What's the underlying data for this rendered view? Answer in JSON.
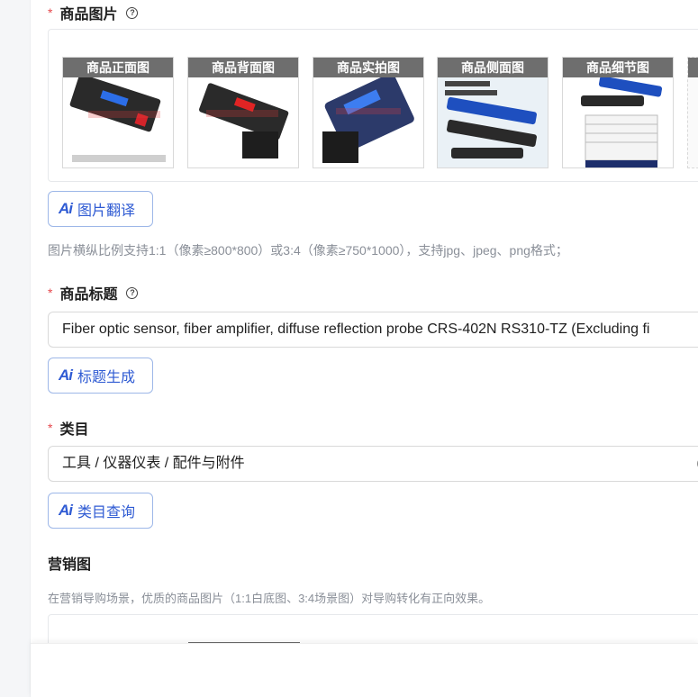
{
  "images_field": {
    "required_mark": "*",
    "label": "商品图片",
    "help_icon": "question-circle-icon",
    "thumbnails": [
      {
        "caption": "商品正面图",
        "art": "front"
      },
      {
        "caption": "商品背面图",
        "art": "back"
      },
      {
        "caption": "商品实拍图",
        "art": "real"
      },
      {
        "caption": "商品侧面图",
        "art": "side"
      },
      {
        "caption": "商品细节图",
        "art": "detail"
      }
    ],
    "ai_button": {
      "icon": "Ai",
      "label": "图片翻译"
    },
    "hint": "图片横纵比例支持1:1（像素≥800*800）或3:4（像素≥750*1000），支持jpg、jpeg、png格式；"
  },
  "title_field": {
    "required_mark": "*",
    "label": "商品标题",
    "help_icon": "question-circle-icon",
    "value": "Fiber optic sensor, fiber amplifier, diffuse reflection probe CRS-402N RS310-TZ (Excluding fi",
    "ai_button": {
      "icon": "Ai",
      "label": "标题生成"
    }
  },
  "category_field": {
    "required_mark": "*",
    "label": "类目",
    "value": "工具 / 仪器仪表 / 配件与附件",
    "ai_button": {
      "icon": "Ai",
      "label": "类目查询"
    }
  },
  "marketing_field": {
    "label": "营销图",
    "hint": "在营销导购场景，优质的商品图片（1:1白底图、3:4场景图）对导购转化有正向效果。"
  },
  "colors": {
    "accent": "#2f5bd3",
    "required": "#e5484d",
    "hint": "#8a8f98"
  }
}
